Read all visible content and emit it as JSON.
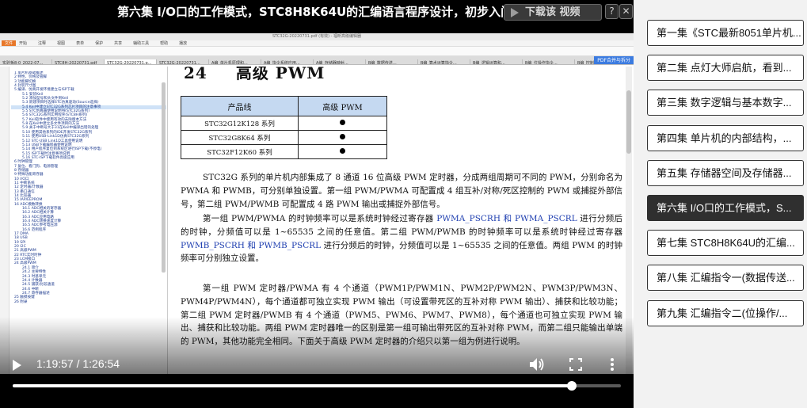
{
  "video": {
    "title": "第六集 I/O口的工作模式，STC8H8K64U的汇编语言程序设计，初步入门",
    "download_label": "下载该 视频",
    "help_label": "?",
    "close_label": "✕",
    "current_time": "1:19:57",
    "duration": "1:26:54",
    "time_text": "1:19:57 / 1:26:54",
    "progress_fraction": 0.9197
  },
  "pdf": {
    "window_title": "STC32G-20220731.pdf (有效) - 福昕高级编辑器",
    "toolbar": [
      "文件",
      "开始",
      "注释",
      "视图",
      "表单",
      "保护",
      "共享",
      "辅助工具",
      "帮助",
      "播放"
    ],
    "tabs": [
      "实验板8-0_2022-07...",
      "STC8H-20220731.pdf",
      "STC32G-20220731.p...",
      "STC32G-20220731...",
      "A编_单片机原理和...",
      "A编_指令系统应用...",
      "A编_存储器映射...",
      "B编_数据传送...",
      "B编_算术运算指令...",
      "B编_逻辑运算和...",
      "B编_位操作指令...",
      "B编_控制转移..."
    ],
    "merge_button": "PDF合并与拆分",
    "toc": [
      "1 单片机基础概述",
      "2 特性、价格及管脚",
      "3 功能脚切换",
      "4 封装尺寸图",
      "5 编译、仿真开发环境建立与ISP下载",
      "5.1 安装Keil",
      "5.2 添加型号和头文件到Keil",
      "5.3 新建项目时选择STC仿真驱动(Source选择)",
      "5.4 Keil中建立STC32G系列芯片项目的注意事项",
      "5.5 STC仿真器使用说明书(STC32G系列)",
      "5.6 STC32G系列实用程序(STC8H系列)",
      "5.7 Keil软件中使用有效的去除版本方法",
      "5.8 在Keil中建立多文件项目的方法",
      "5.9 关于中断号大于31在Keil中编译出错的处理",
      "5.10 使用其他系列的IDE开发STC32G系列",
      "5.11 使用USB-Link1D仿真STC32G系列",
      "5.12 STC-USB Link1D工具使用说明",
      "5.13 USB下载编程器使用说明",
      "5.14 用户程序复位到系统区进行ISP下载(不停电)",
      "5.15 ISP下载时注意事项说明",
      "5.16 STC-ISP下载软件高级应用",
      "6 时钟管理",
      "7 复位、看门狗、电源管理",
      "8 存储器",
      "9 特殊功能寄存器",
      "10 I/O口",
      "11 中断系统",
      "12 定时器/计数器",
      "13 串口通信",
      "14 比较器",
      "15 IAP/EEPROM",
      "16 ADC模数转换",
      "16.1 ADC相关的寄存器",
      "16.2 ADC相关计算",
      "16.3 ADC应用电路",
      "16.4 ADC转换速度计算",
      "16.5 ADC参考电压源",
      "16.6 范例程序",
      "17 DMA",
      "18 USB",
      "19 SPI",
      "20 I2C",
      "21 高级PWM",
      "22 RTC实时时钟",
      "23 LCM接口",
      "24 高级PWM",
      "24.1 简介",
      "24.2 主要特性",
      "24.3 时基单元",
      "24.4 计数器",
      "24.5 捕获/比较通道",
      "24.6 中断",
      "24.7 寄存器描述",
      "25 触摸按键",
      "26 附录"
    ],
    "heading_number": "24",
    "heading_title": "高级 PWM",
    "table": {
      "headers": [
        "产品线",
        "高级 PWM"
      ],
      "rows": [
        "STC32G12K128 系列",
        "STC32G8K64 系列",
        "STC32F12K60 系列"
      ]
    },
    "para1": "STC32G 系列的单片机内部集成了 8 通道 16 位高级 PWM 定时器，分成两组周期可不同的 PWM，分别命名为 PWMA 和 PWMB，可分别单独设置。第一组 PWM/PWMA 可配置成 4 组互补/对称/死区控制的 PWM 或捕捉外部信号，第二组 PWM/PWMB 可配置成 4 路 PWM 输出或捕捉外部信号。",
    "para2_a": "第一组 PWM/PWMA 的时钟频率可以是系统时钟经过寄存器 ",
    "para2_hl1": "PWMA_PSCRH 和 PWMA_PSCRL",
    "para2_b": " 进行分频后的时钟，分频值可以是 1~65535 之间的任意值。第二组 PWM/PWMB 的时钟频率可以是系统时钟经过寄存器 ",
    "para2_hl2": "PWMB_PSCRH 和 PWMB_PSCRL",
    "para2_c": " 进行分频后的时钟，分频值可以是 1~65535 之间的任意值。两组 PWM 的时钟频率可分别独立设置。",
    "para3": "第一组 PWM 定时器/PWMA 有 4 个通道（PWM1P/PWM1N、PWM2P/PWM2N、PWM3P/PWM3N、PWM4P/PWM4N），每个通道都可独立实现 PWM 输出（可设置带死区的互补对称 PWM 输出）、捕获和比较功能；第二组 PWM 定时器/PWMB 有 4 个通道（PWM5、PWM6、PWM7、PWM8），每个通道也可独立实现 PWM 输出、捕获和比较功能。两组 PWM 定时器唯一的区别是第一组可输出带死区的互补对称 PWM，而第二组只能输出单端的 PWM，其他功能完全相同。下面关于高级 PWM 定时器的介绍只以第一组为例进行说明。"
  },
  "episodes": [
    "第一集《STC最新8051单片机...",
    "第二集 点灯大师启航，看到...",
    "第三集 数字逻辑与基本数字...",
    "第四集 单片机的内部结构，...",
    "第五集 存储器空间及存储器...",
    "第六集 I/O口的工作模式，S...",
    "第七集 STC8H8K64U的汇编...",
    "第八集 汇编指令一(数据传送...",
    "第九集 汇编指令二(位操作/..."
  ],
  "active_episode_index": 5,
  "colors": {
    "accent_blue": "#1f3fb0",
    "table_header": "#c5d9f1",
    "active_episode": "#2f2f2f",
    "merge_button": "#3b7be0"
  }
}
